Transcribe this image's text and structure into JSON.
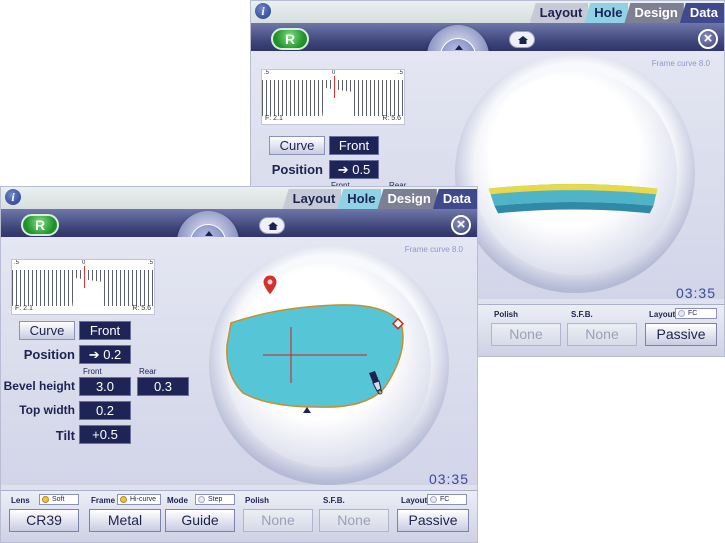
{
  "tabs": [
    "Layout",
    "Hole",
    "Design",
    "Data"
  ],
  "front": {
    "r_label": "R",
    "frame_curve": "Frame curve 8.0",
    "barcode": {
      "ticks": [
        ".5",
        "0",
        ".5"
      ],
      "left": "F: 2.1",
      "right": "R: 5.6"
    },
    "curve_label": "Curve",
    "curve_value": "Front",
    "position_label": "Position",
    "position_value": "➔ 0.2",
    "front_sub": "Front",
    "rear_sub": "Rear",
    "bevel_label": "Bevel height",
    "bevel_front": "3.0",
    "bevel_rear": "0.3",
    "top_width_label": "Top width",
    "top_width_value": "0.2",
    "tilt_label": "Tilt",
    "tilt_value": "+0.5",
    "time": "03:35",
    "bottom": {
      "lens_label": "Lens",
      "lens_chip": "Soft",
      "lens_btn": "CR39",
      "frame_label": "Frame",
      "frame_chip": "Hi-curve",
      "frame_btn": "Metal",
      "mode_label": "Mode",
      "mode_chip": "Step",
      "mode_btn": "Guide",
      "polish_label": "Polish",
      "polish_btn": "None",
      "sfb_label": "S.F.B.",
      "sfb_btn": "None",
      "layout_label": "Layout",
      "layout_chip": "FC",
      "layout_btn": "Passive"
    }
  },
  "back": {
    "r_label": "R",
    "frame_curve": "Frame curve 8.0",
    "barcode": {
      "ticks": [
        ".5",
        "0",
        ".5"
      ],
      "left": "F: 2.1",
      "right": "R: 5.6"
    },
    "curve_label": "Curve",
    "curve_value": "Front",
    "position_label": "Position",
    "position_value": "➔ 0.5",
    "front_sub": "Front",
    "rear_sub": "Rear",
    "time": "03:35",
    "bottom": {
      "polish_label": "Polish",
      "polish_btn": "None",
      "sfb_label": "S.F.B.",
      "sfb_btn": "None",
      "layout_label": "Layout",
      "layout_chip": "FC",
      "layout_btn": "Passive"
    }
  },
  "colors": {
    "accent_green": "#2fa83a",
    "dark_value": "#1f2456",
    "lens_fill": "#56c6d6",
    "tab_hole": "#8fd2e6"
  }
}
